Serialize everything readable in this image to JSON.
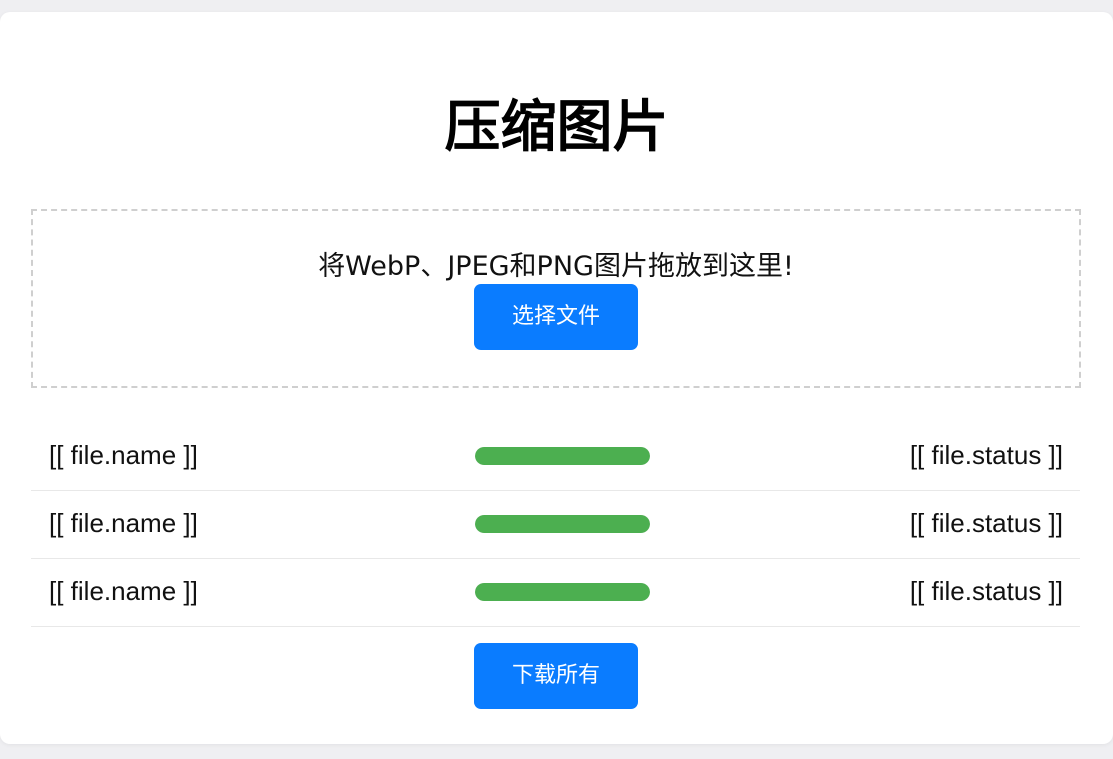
{
  "page": {
    "title": "压缩图片"
  },
  "dropzone": {
    "text": "将WebP、JPEG和PNG图片拖放到这里!",
    "select_button": "选择文件"
  },
  "files": [
    {
      "name": "[[ file.name ]]",
      "status": "[[ file.status ]]",
      "progress": 1.0
    },
    {
      "name": "[[ file.name ]]",
      "status": "[[ file.status ]]",
      "progress": 1.0
    },
    {
      "name": "[[ file.name ]]",
      "status": "[[ file.status ]]",
      "progress": 1.0
    }
  ],
  "actions": {
    "download_all": "下载所有"
  },
  "colors": {
    "accent": "#0a7cff",
    "progress": "#4caf50",
    "background": "#efeff2"
  }
}
